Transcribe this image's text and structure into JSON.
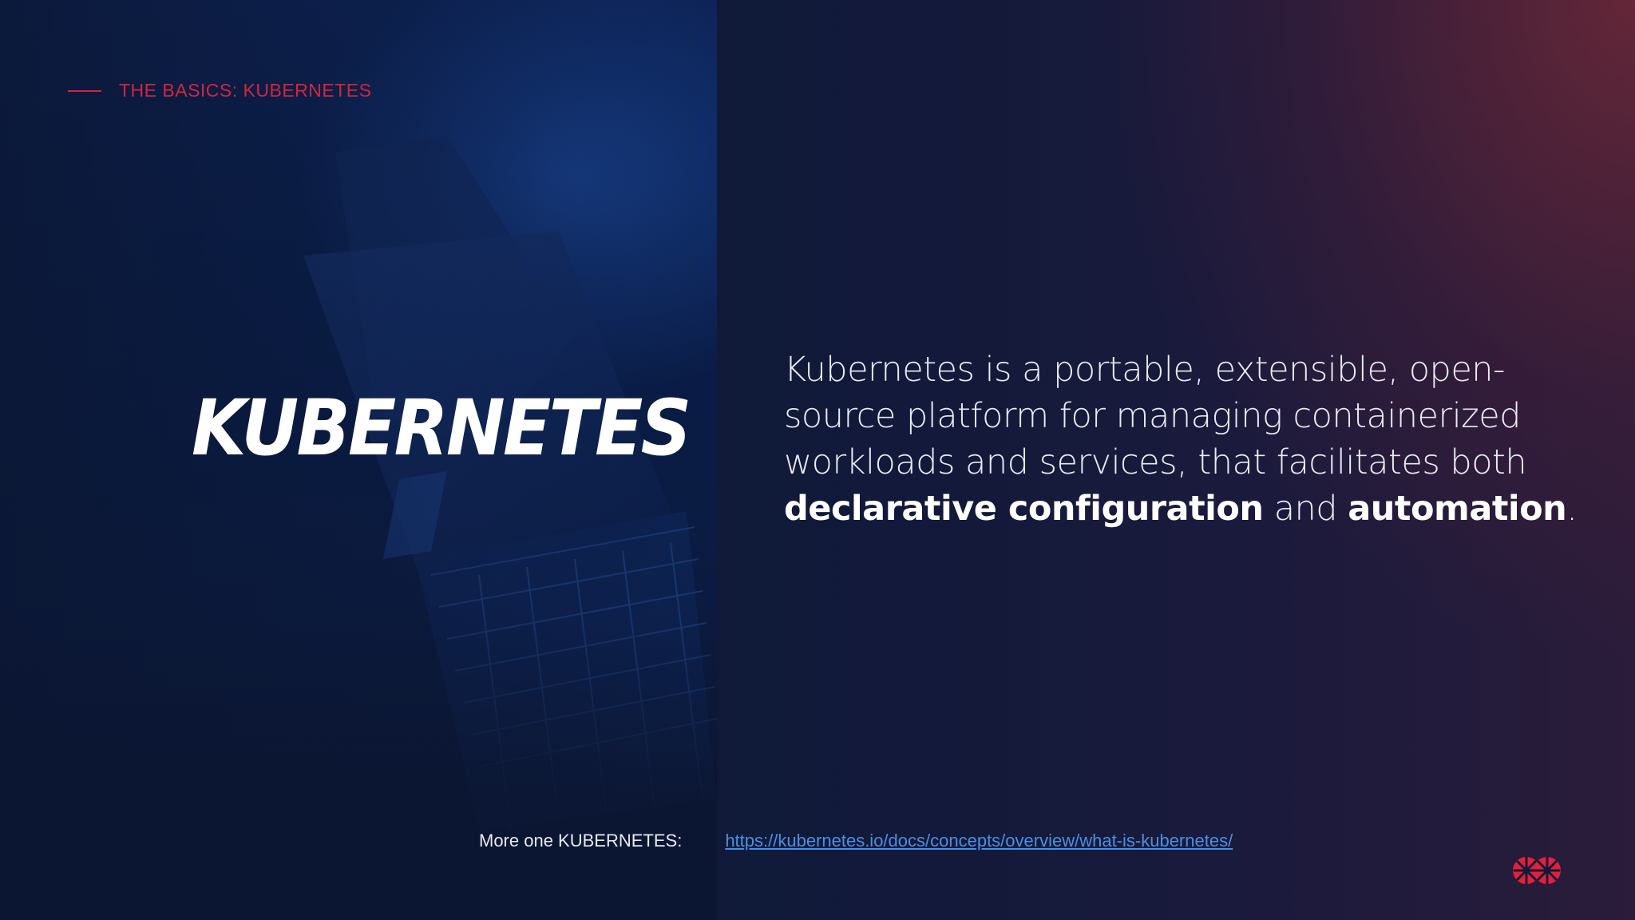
{
  "section_label": "THE BASICS: KUBERNETES",
  "title": "KUBERNETES",
  "description": {
    "part1": "Kubernetes is a portable, extensible, open-source platform for managing containerized workloads and services, that facilitates both ",
    "bold1": "declarative configuration",
    "part2": " and ",
    "bold2": "automation",
    "part3": "."
  },
  "footer": {
    "label": "More one KUBERNETES:",
    "link_text": "https://kubernetes.io/docs/concepts/overview/what-is-kubernetes/"
  },
  "colors": {
    "accent": "#d3263c",
    "link": "#4a8fe0",
    "background": "#0b1530"
  },
  "icons": {
    "logo": "red-starburst-logo-icon"
  }
}
